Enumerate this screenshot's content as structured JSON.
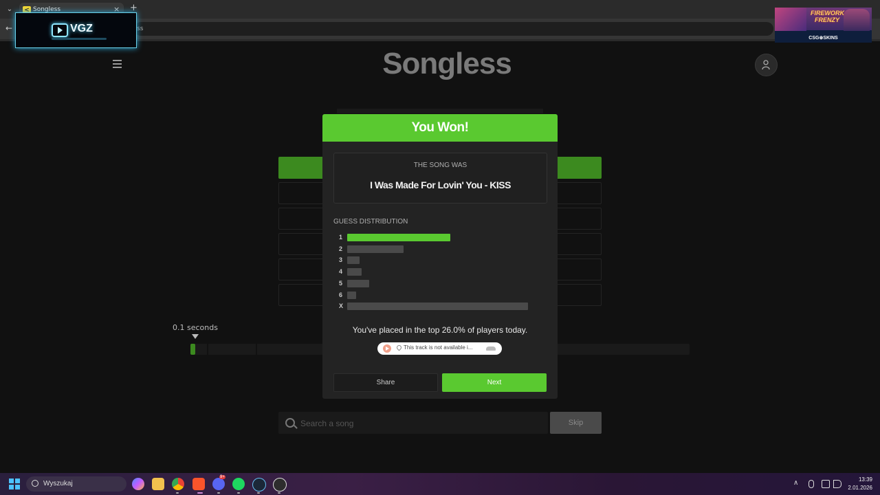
{
  "browser": {
    "tab_title": "Songless",
    "tab_close": "×",
    "new_tab": "+",
    "url_fragment": "ss"
  },
  "overlays": {
    "vgz_logo": "VGZ",
    "ad_title": "FIREWORK FRENZY",
    "ad_brand": "CSG⊛SKINS"
  },
  "page": {
    "logo": "Songless",
    "time_label": "0.1 seconds",
    "progress_fraction": 0.01,
    "search_placeholder": "Search a song",
    "skip_label": "Skip"
  },
  "modal": {
    "header": "You Won!",
    "song_was_label": "THE SONG WAS",
    "song_title": "I Was Made For Lovin' You - KISS",
    "distribution_label": "GUESS DISTRIBUTION",
    "distribution": [
      {
        "label": "1",
        "fraction": 0.57,
        "highlight": true
      },
      {
        "label": "2",
        "fraction": 0.31,
        "highlight": false
      },
      {
        "label": "3",
        "fraction": 0.07,
        "highlight": false
      },
      {
        "label": "4",
        "fraction": 0.08,
        "highlight": false
      },
      {
        "label": "5",
        "fraction": 0.12,
        "highlight": false
      },
      {
        "label": "6",
        "fraction": 0.05,
        "highlight": false
      },
      {
        "label": "X",
        "fraction": 1.0,
        "highlight": false
      }
    ],
    "placement_text": "You've placed in the top 26.0% of players today.",
    "track_embed_text": "This track is not available i...",
    "share_label": "Share",
    "next_label": "Next"
  },
  "taskbar": {
    "search_text": "Wyszukaj",
    "clock_time": "13:39",
    "clock_date": "2.01.2026",
    "discord_badge": "9+"
  },
  "colors": {
    "accent_green": "#5ac930",
    "dark_green": "#3c8a1f",
    "bar_gray": "#4a4a4a"
  }
}
